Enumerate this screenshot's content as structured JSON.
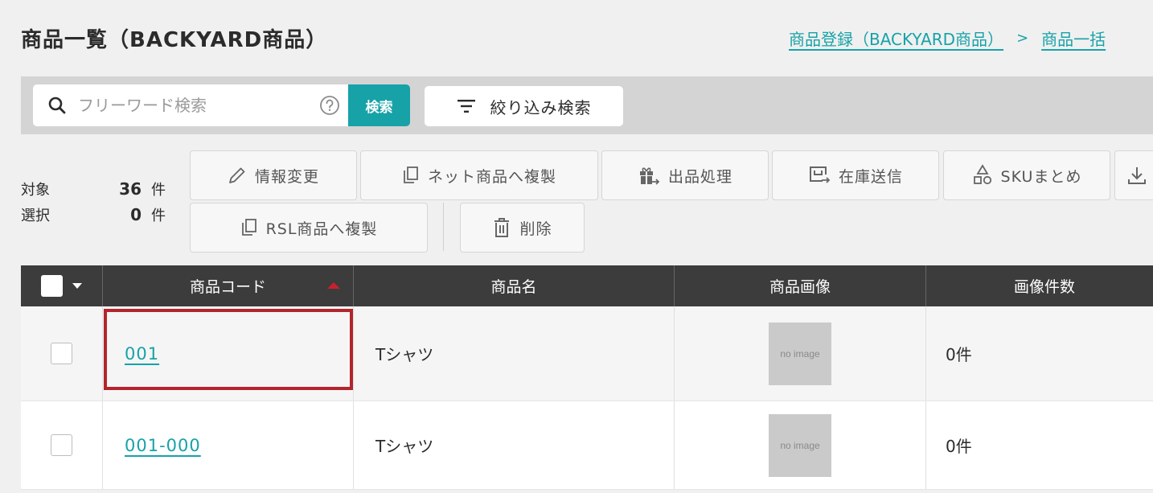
{
  "header": {
    "title": "商品一覧（BACKYARD商品）",
    "breadcrumb": [
      "商品登録（BACKYARD商品）",
      "商品一括"
    ]
  },
  "search": {
    "placeholder": "フリーワード検索",
    "button_label": "検索",
    "filter_label": "絞り込み検索"
  },
  "counts": {
    "target_label": "対象",
    "target_value": "36",
    "target_unit": "件",
    "selected_label": "選択",
    "selected_value": "0",
    "selected_unit": "件"
  },
  "actions": {
    "edit_info": "情報変更",
    "copy_to_net": "ネット商品へ複製",
    "listing": "出品処理",
    "stock_send": "在庫送信",
    "sku_merge": "SKUまとめ",
    "copy_to_rsl": "RSL商品へ複製",
    "delete": "削除"
  },
  "table": {
    "columns": [
      "商品コード",
      "商品名",
      "商品画像",
      "画像件数"
    ],
    "rows": [
      {
        "code": "001",
        "name": "Tシャツ",
        "image": "no image",
        "image_count": "0件"
      },
      {
        "code": "001-000",
        "name": "Tシャツ",
        "image": "no image",
        "image_count": "0件"
      }
    ]
  },
  "colors": {
    "accent": "#17a2a8",
    "header_bg": "#3c3c3c",
    "highlight": "#b3252d"
  }
}
